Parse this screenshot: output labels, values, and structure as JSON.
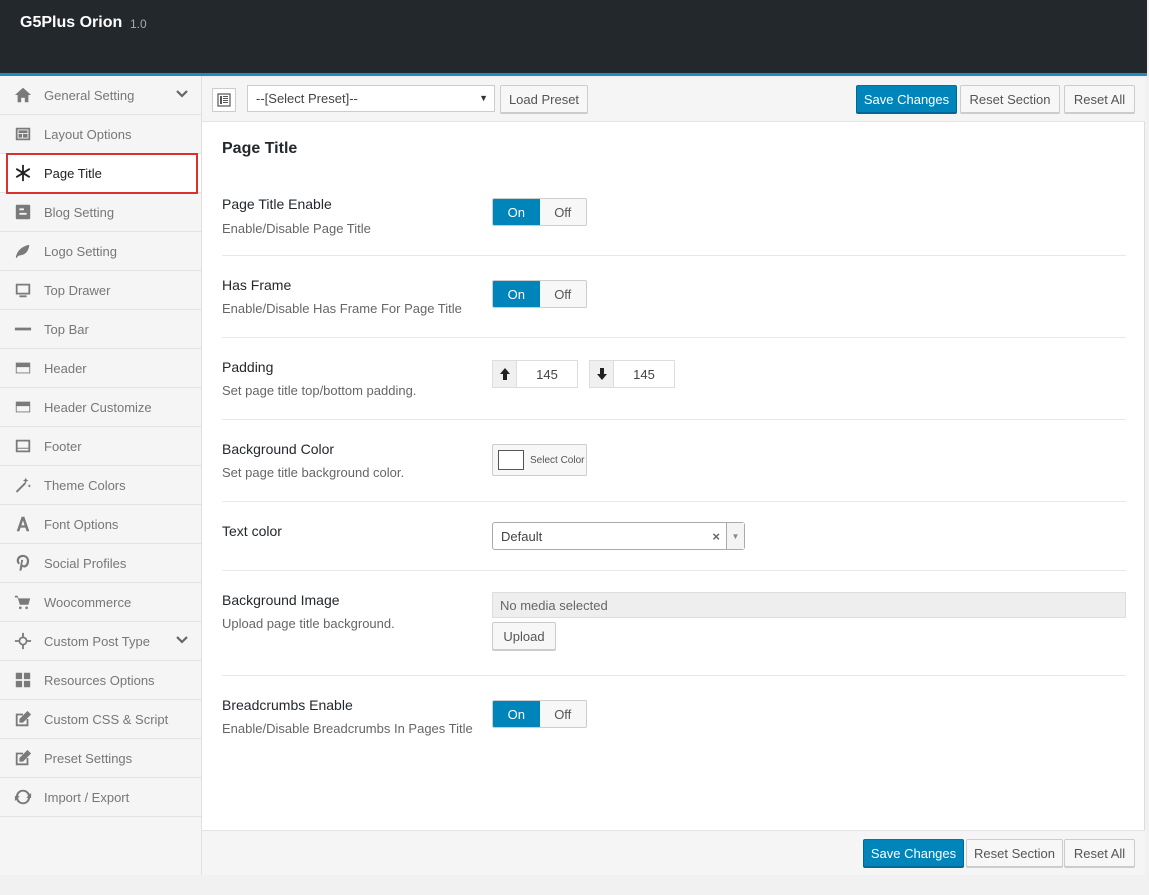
{
  "app": {
    "title": "G5Plus Orion",
    "version": "1.0"
  },
  "sidebar": {
    "items": [
      {
        "label": "General Setting",
        "icon": "home-icon",
        "chevron": true
      },
      {
        "label": "Layout Options",
        "icon": "layout-icon"
      },
      {
        "label": "Page Title",
        "icon": "asterisk-icon",
        "active": true
      },
      {
        "label": "Blog Setting",
        "icon": "blogger-icon"
      },
      {
        "label": "Logo Setting",
        "icon": "leaf-icon"
      },
      {
        "label": "Top Drawer",
        "icon": "monitor-icon"
      },
      {
        "label": "Top Bar",
        "icon": "minus-bar-icon"
      },
      {
        "label": "Header",
        "icon": "header-icon"
      },
      {
        "label": "Header Customize",
        "icon": "header-customize-icon"
      },
      {
        "label": "Footer",
        "icon": "footer-icon"
      },
      {
        "label": "Theme Colors",
        "icon": "magic-wand-icon"
      },
      {
        "label": "Font Options",
        "icon": "font-icon"
      },
      {
        "label": "Social Profiles",
        "icon": "pinterest-icon"
      },
      {
        "label": "Woocommerce",
        "icon": "cart-icon"
      },
      {
        "label": "Custom Post Type",
        "icon": "crosshair-icon",
        "chevron": true
      },
      {
        "label": "Resources Options",
        "icon": "grid-icon"
      },
      {
        "label": "Custom CSS & Script",
        "icon": "edit-icon"
      },
      {
        "label": "Preset Settings",
        "icon": "edit-icon"
      },
      {
        "label": "Import / Export",
        "icon": "refresh-icon"
      }
    ]
  },
  "toolbar": {
    "preset_placeholder": "--[Select Preset]--",
    "load_preset": "Load Preset",
    "save_changes": "Save Changes",
    "reset_section": "Reset Section",
    "reset_all": "Reset All"
  },
  "section": {
    "title": "Page Title",
    "page_title_enable": {
      "label": "Page Title Enable",
      "desc": "Enable/Disable Page Title",
      "on": "On",
      "off": "Off",
      "value": "On"
    },
    "has_frame": {
      "label": "Has Frame",
      "desc": "Enable/Disable Has Frame For Page Title",
      "on": "On",
      "off": "Off",
      "value": "On"
    },
    "padding": {
      "label": "Padding",
      "desc": "Set page title top/bottom padding.",
      "top": "145",
      "bottom": "145"
    },
    "background_color": {
      "label": "Background Color",
      "desc": "Set page title background color.",
      "button": "Select Color"
    },
    "text_color": {
      "label": "Text color",
      "value": "Default",
      "clear": "×"
    },
    "background_image": {
      "label": "Background Image",
      "desc": "Upload page title background.",
      "media": "No media selected",
      "upload": "Upload"
    },
    "breadcrumbs_enable": {
      "label": "Breadcrumbs Enable",
      "desc": "Enable/Disable Breadcrumbs In Pages Title",
      "on": "On",
      "off": "Off",
      "value": "On"
    }
  },
  "footer": {
    "save_changes": "Save Changes",
    "reset_section": "Reset Section",
    "reset_all": "Reset All"
  },
  "colors": {
    "accent": "#0085ba",
    "header_bg": "#23282d",
    "active_outline": "#d9322e"
  }
}
